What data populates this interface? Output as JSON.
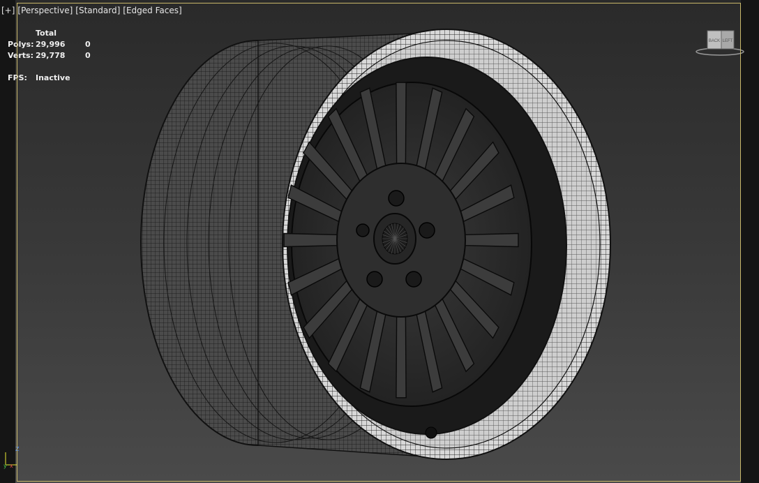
{
  "viewport": {
    "menu": [
      "[+]",
      "[Perspective]",
      "[Standard]",
      "[Edged Faces]"
    ]
  },
  "stats": {
    "header": "Total",
    "rows": [
      {
        "label": "Polys:",
        "total": "29,996",
        "selected": "0"
      },
      {
        "label": "Verts:",
        "total": "29,778",
        "selected": "0"
      }
    ],
    "fps_label": "FPS:",
    "fps_value": "Inactive"
  },
  "viewcube": {
    "face_back": "BACK",
    "face_left": "LEFT"
  },
  "axis": {
    "z": "Z",
    "y": "y",
    "x": "x"
  },
  "colors": {
    "frame_accent": "#c9b86a",
    "wire": "#0b0b0b",
    "lip": "#e8e8e8"
  }
}
